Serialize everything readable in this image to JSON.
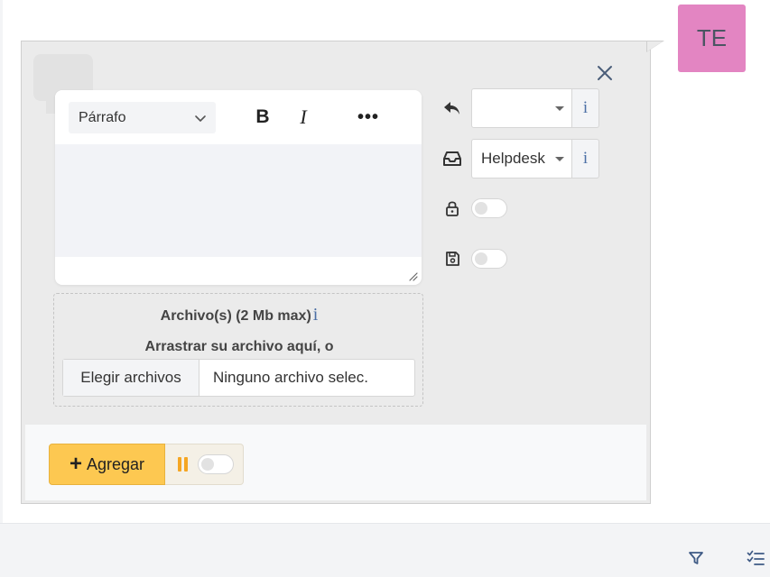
{
  "avatar": {
    "initials": "TE",
    "color": "#e385c2"
  },
  "editor": {
    "paragraph_select": "Párrafo",
    "bold_label": "B",
    "italic_label": "I",
    "more_label": "•••",
    "content": ""
  },
  "attachments": {
    "title": "Archivo(s) (2 Mb max)",
    "info_symbol": "i",
    "drag_text": "Arrastrar su archivo aquí, o",
    "choose_button": "Elegir archivos",
    "no_file_text": "Ninguno archivo selec."
  },
  "side_controls": {
    "reply_select": {
      "value": "",
      "info_symbol": "i"
    },
    "inbox_select": {
      "value": "Helpdesk",
      "info_symbol": "i"
    },
    "private_toggle": {
      "on": false
    },
    "save_toggle": {
      "on": false
    }
  },
  "footer": {
    "add_button": "Agregar",
    "add_symbol": "+",
    "pause_toggle": {
      "on": false
    }
  },
  "icons": [
    "close-icon",
    "reply-icon",
    "inbox-icon",
    "lock-icon",
    "save-icon",
    "pause-icon",
    "filter-icon",
    "checklist-icon",
    "chevron-down-icon"
  ],
  "colors": {
    "accent_yellow": "#fdc851",
    "info_blue": "#4b6fa5",
    "avatar_pink": "#e385c2"
  }
}
